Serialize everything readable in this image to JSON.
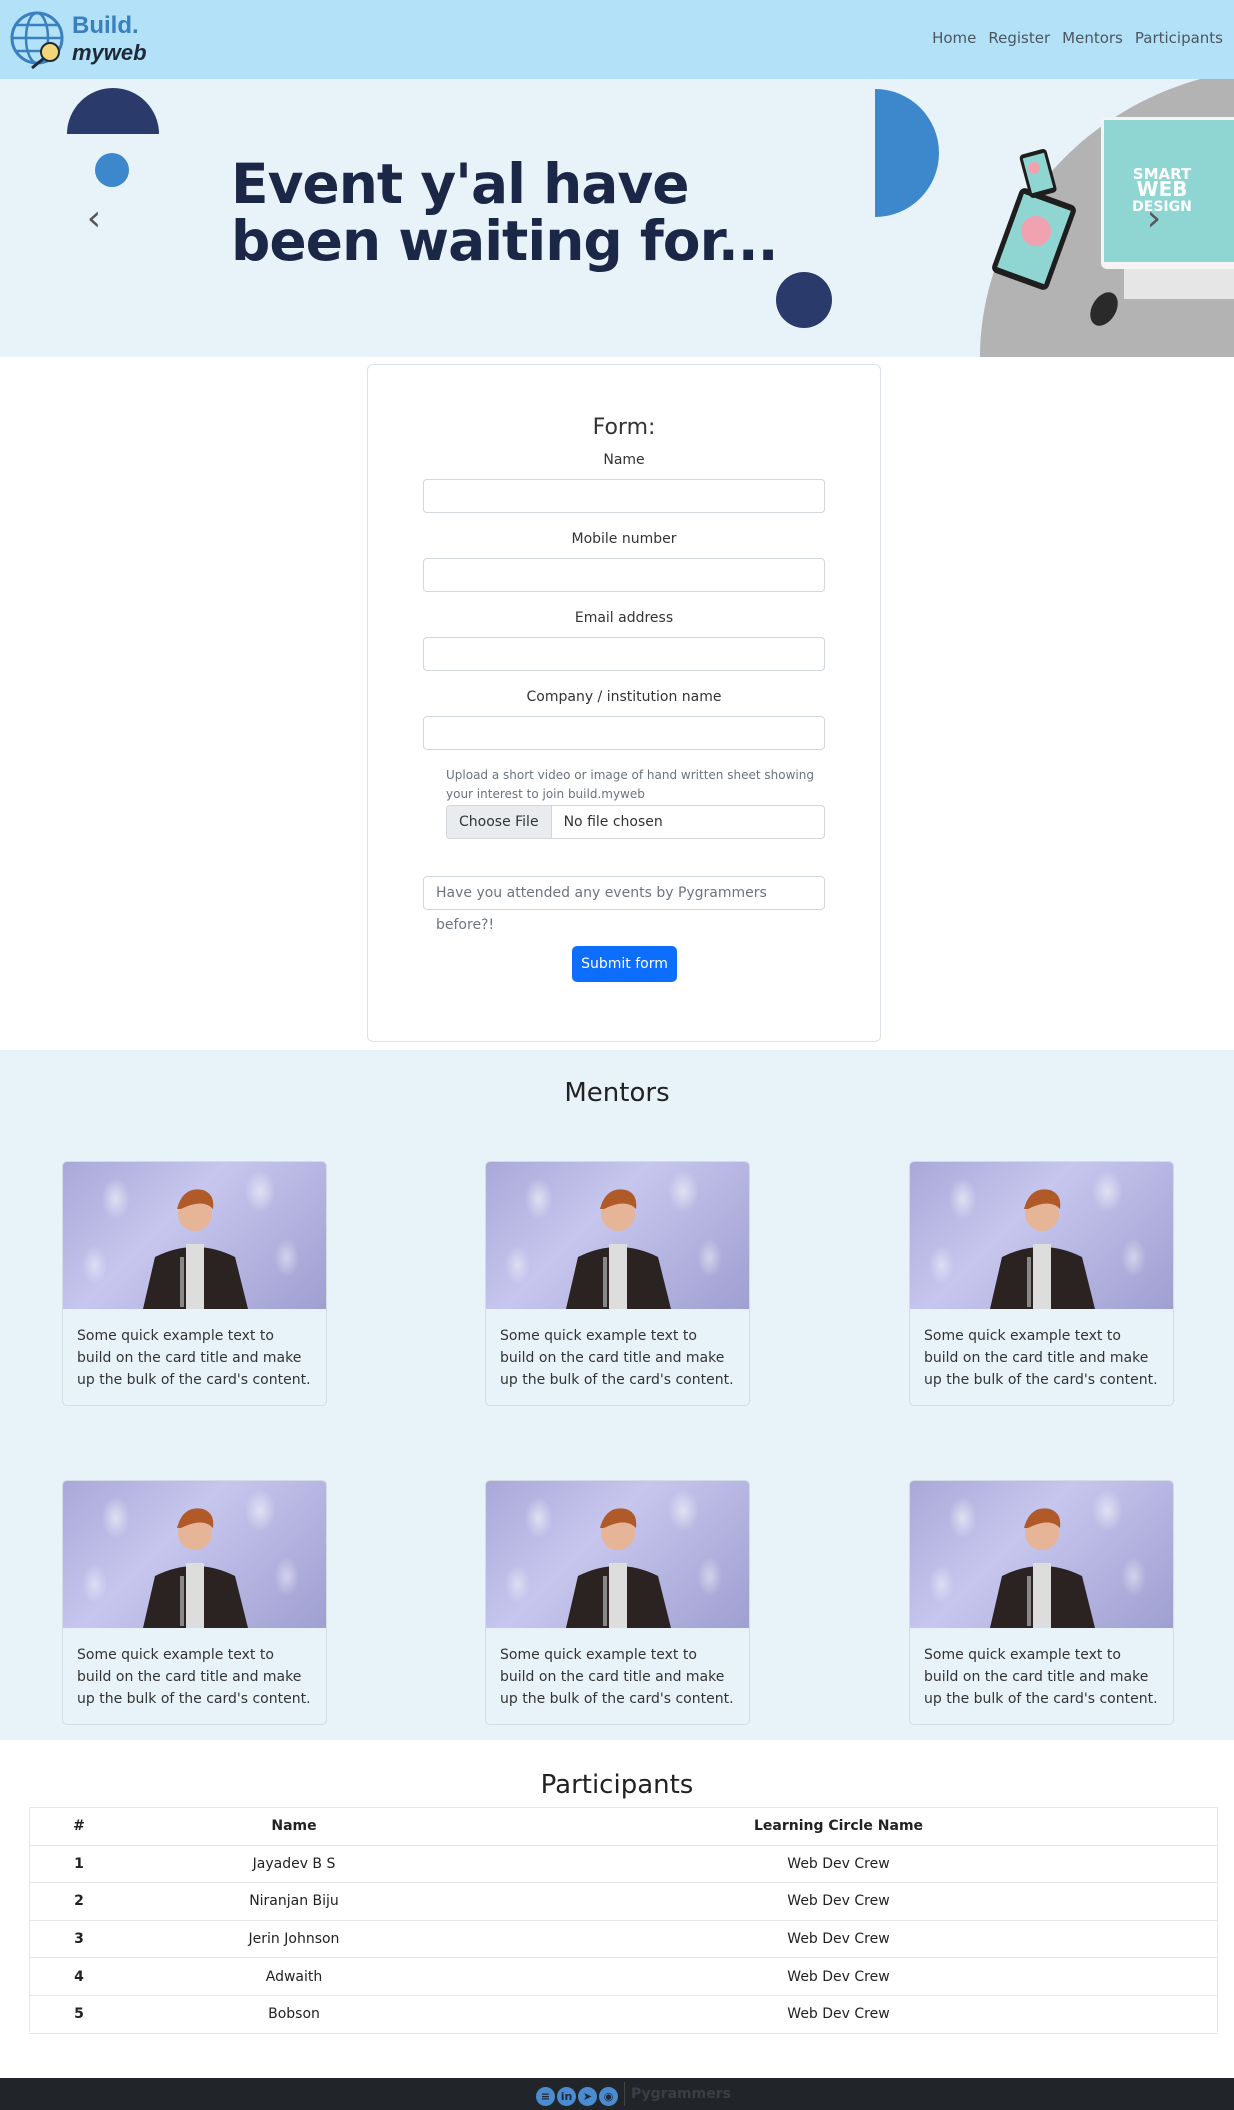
{
  "brand": {
    "line1": "Build.",
    "line2": "myweb"
  },
  "nav": {
    "items": [
      "Home",
      "Register",
      "Mentors",
      "Participants"
    ]
  },
  "hero": {
    "headline_line1": "Event y'al have",
    "headline_line2": "been waiting for...",
    "prev_icon": "chevron-left-icon",
    "next_icon": "chevron-right-icon",
    "monitor_text": [
      "SMART",
      "WEB",
      "DESIGN"
    ],
    "colors": {
      "navy": "#2a3b6b",
      "blue": "#3d87cc",
      "bg": "#e8f2f9"
    }
  },
  "form": {
    "title": "Form:",
    "labels": {
      "name": "Name",
      "mobile": "Mobile number",
      "email": "Email address",
      "company": "Company / institution name"
    },
    "upload_help": "Upload a short video or image of hand written sheet showing your interest to join build.myweb",
    "file_button": "Choose File",
    "file_status": "No file chosen",
    "question_placeholder": "Have you attended any events by Pygrammers before?!",
    "submit": "Submit form"
  },
  "mentors": {
    "title": "Mentors",
    "cards": [
      {
        "text": "Some quick example text to build on the card title and make up the bulk of the card's content."
      },
      {
        "text": "Some quick example text to build on the card title and make up the bulk of the card's content."
      },
      {
        "text": "Some quick example text to build on the card title and make up the bulk of the card's content."
      },
      {
        "text": "Some quick example text to build on the card title and make up the bulk of the card's content."
      },
      {
        "text": "Some quick example text to build on the card title and make up the bulk of the card's content."
      },
      {
        "text": "Some quick example text to build on the card title and make up the bulk of the card's content."
      }
    ]
  },
  "participants": {
    "title": "Participants",
    "columns": [
      "#",
      "Name",
      "Learning Circle Name"
    ],
    "rows": [
      [
        "1",
        "Jayadev B S",
        "Web Dev Crew"
      ],
      [
        "2",
        "Niranjan Biju",
        "Web Dev Crew"
      ],
      [
        "3",
        "Jerin Johnson",
        "Web Dev Crew"
      ],
      [
        "4",
        "Adwaith",
        "Web Dev Crew"
      ],
      [
        "5",
        "Bobson",
        "Web Dev Crew"
      ]
    ]
  },
  "footer": {
    "icons": [
      "spotify-icon",
      "linkedin-icon",
      "telegram-icon",
      "instagram-icon"
    ],
    "brand": "Pygrammers"
  }
}
